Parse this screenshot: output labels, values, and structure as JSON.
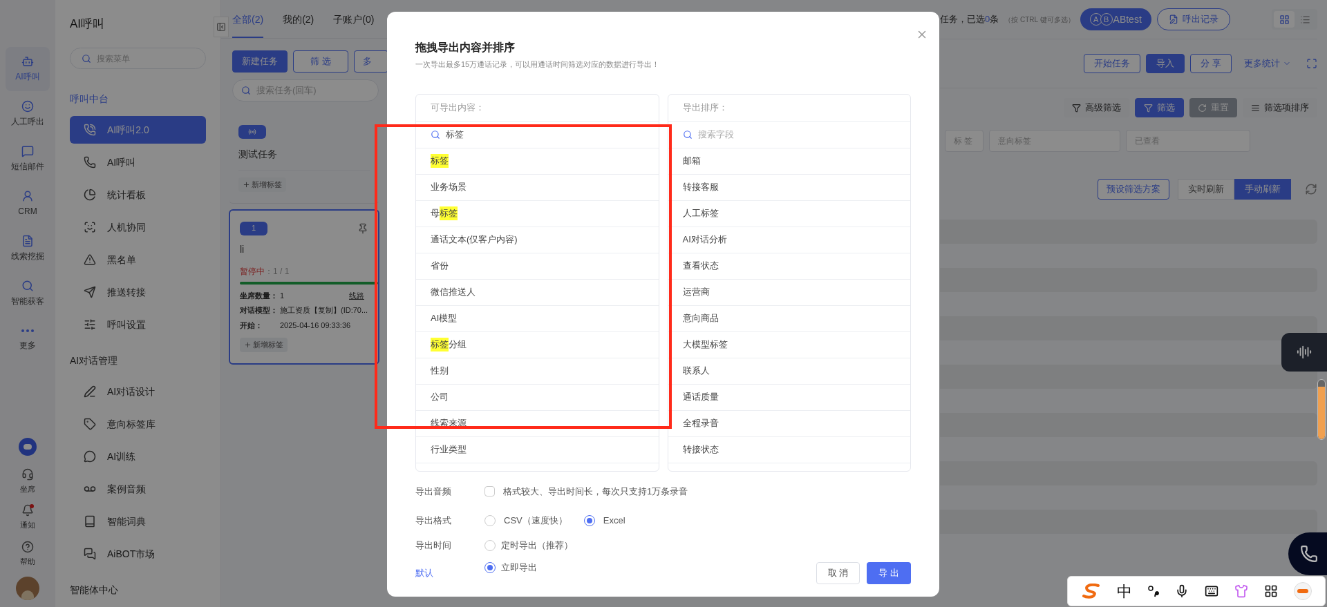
{
  "rail": {
    "items": [
      {
        "label": "AI呼叫",
        "selected": true
      },
      {
        "label": "人工呼出",
        "selected": false
      },
      {
        "label": "短信邮件",
        "selected": false
      },
      {
        "label": "CRM",
        "selected": false
      },
      {
        "label": "线索挖掘",
        "selected": false
      },
      {
        "label": "智能获客",
        "selected": false
      },
      {
        "label": "更多",
        "selected": false
      }
    ],
    "bottom_items": [
      {
        "label": "坐席",
        "badge": false
      },
      {
        "label": "通知",
        "badge": true
      },
      {
        "label": "帮助",
        "badge": false
      }
    ]
  },
  "menu": {
    "title": "AI呼叫",
    "search_placeholder": "搜索菜单",
    "sections": [
      {
        "title": "呼叫中台",
        "active": true,
        "items": [
          {
            "label": "AI呼叫2.0",
            "selected": true
          },
          {
            "label": "AI呼叫",
            "selected": false
          },
          {
            "label": "统计看板",
            "selected": false
          },
          {
            "label": "人机协同",
            "selected": false
          },
          {
            "label": "黑名单",
            "selected": false
          },
          {
            "label": "推送转接",
            "selected": false
          },
          {
            "label": "呼叫设置",
            "selected": false
          }
        ]
      },
      {
        "title": "AI对话管理",
        "active": false,
        "items": [
          {
            "label": "AI对话设计",
            "selected": false
          },
          {
            "label": "意向标签库",
            "selected": false
          },
          {
            "label": "AI训练",
            "selected": false
          },
          {
            "label": "案例音频",
            "selected": false
          },
          {
            "label": "智能词典",
            "selected": false
          },
          {
            "label": "AiBOT市场",
            "selected": false
          }
        ]
      },
      {
        "title": "智能体中心",
        "active": false
      }
    ]
  },
  "content": {
    "tabs": [
      {
        "label": "全部(2)",
        "selected": true
      },
      {
        "label": "我的(2)",
        "selected": false
      },
      {
        "label": "子账户(0)",
        "selected": false
      }
    ],
    "actions": [
      {
        "label": "新建任务",
        "kind": "solid"
      },
      {
        "label": "筛 选",
        "kind": "outline"
      },
      {
        "label": "多",
        "kind": "outline"
      }
    ],
    "task_search_placeholder": "搜索任务(回车)",
    "tasks": [
      {
        "kind": "simple",
        "name": "测试任务",
        "selected": false,
        "add_tag": "新增标签"
      },
      {
        "kind": "detail",
        "badge": "1",
        "name": "li",
        "selected": true,
        "status": "暂停中",
        "progress": "：1 / 1",
        "level": 1,
        "link": "线路",
        "fields": [
          {
            "label": "坐席数量：",
            "value": "1"
          },
          {
            "label": "对话模型：",
            "value": "施工资质【复制】(ID:70..."
          },
          {
            "label": "开始：",
            "value": "2025-04-16 09:33:36"
          }
        ],
        "add_tag": "新增标签"
      }
    ],
    "selection": {
      "prefix": "任务，已选",
      "count": "0",
      "suffix": "条",
      "hint": "（按 CTRL 键可多选）"
    },
    "ab_button": {
      "letters": [
        "A",
        "B"
      ],
      "label": "ABtest"
    },
    "records_button": "呼出记录",
    "views": [
      {
        "kind": "grid",
        "selected": true
      },
      {
        "kind": "list",
        "selected": false
      }
    ],
    "toolbar": [
      {
        "label": "开始任务",
        "kind": "outline"
      },
      {
        "label": "导入",
        "kind": "solid"
      },
      {
        "label": "分 享",
        "kind": "outline"
      }
    ],
    "more_stats": "更多统计",
    "filters": [
      {
        "label": "高级筛选",
        "kind": "light"
      },
      {
        "label": "筛选",
        "kind": "solid"
      },
      {
        "label": "重置",
        "kind": "grey"
      },
      {
        "label": "筛选项排序",
        "kind": "light"
      }
    ],
    "filter_fields": [
      "标 签",
      "意向标签",
      "已查看"
    ],
    "preset": "预设筛选方案",
    "refresh_modes": [
      {
        "label": "实时刷新",
        "selected": false
      },
      {
        "label": "手动刷新",
        "selected": true
      }
    ]
  },
  "dialog": {
    "title": "拖拽导出内容并排序",
    "subtitle": "一次导出最多15万通话记录，可以用通话时间筛选对应的数据进行导出！",
    "available": {
      "header": "可导出内容：",
      "search_value": "标签",
      "items": [
        [
          {
            "text": "标签",
            "match": true
          }
        ],
        [
          {
            "text": "业务场景",
            "match": false
          }
        ],
        [
          {
            "text": "母",
            "match": false
          },
          {
            "text": "标签",
            "match": true
          }
        ],
        [
          {
            "text": "通话文本(仅客户内容)",
            "match": false
          }
        ],
        [
          {
            "text": "省份",
            "match": false
          }
        ],
        [
          {
            "text": "微信推送人",
            "match": false
          }
        ],
        [
          {
            "text": "AI模型",
            "match": false
          }
        ],
        [
          {
            "text": "标签",
            "match": true
          },
          {
            "text": "分组",
            "match": false
          }
        ],
        [
          {
            "text": "性别",
            "match": false
          }
        ],
        [
          {
            "text": "公司",
            "match": false
          }
        ],
        [
          {
            "text": "线索来源",
            "match": false
          }
        ],
        [
          {
            "text": "行业类型",
            "match": false
          }
        ]
      ]
    },
    "order": {
      "header": "导出排序：",
      "search_placeholder": "搜索字段",
      "items": [
        "邮箱",
        "转接客服",
        "人工标签",
        "AI对话分析",
        "查看状态",
        "运营商",
        "意向商品",
        "大模型标签",
        "联系人",
        "通话质量",
        "全程录音",
        "转接状态"
      ]
    },
    "audio": {
      "label": "导出音频",
      "checked": false,
      "text": "格式较大、导出时间长，每次只支持1万条录音"
    },
    "format": {
      "label": "导出格式",
      "options": [
        {
          "label": "CSV（速度快）",
          "selected": false
        },
        {
          "label": "Excel",
          "selected": true
        }
      ]
    },
    "time": {
      "label": "导出时间",
      "options": [
        {
          "label": "定时导出（推荐）",
          "selected": false
        },
        {
          "label": "立即导出",
          "selected": true
        }
      ]
    },
    "default_link": "默认",
    "cancel": "取 消",
    "confirm": "导 出"
  },
  "ime": {
    "mode": "中"
  }
}
